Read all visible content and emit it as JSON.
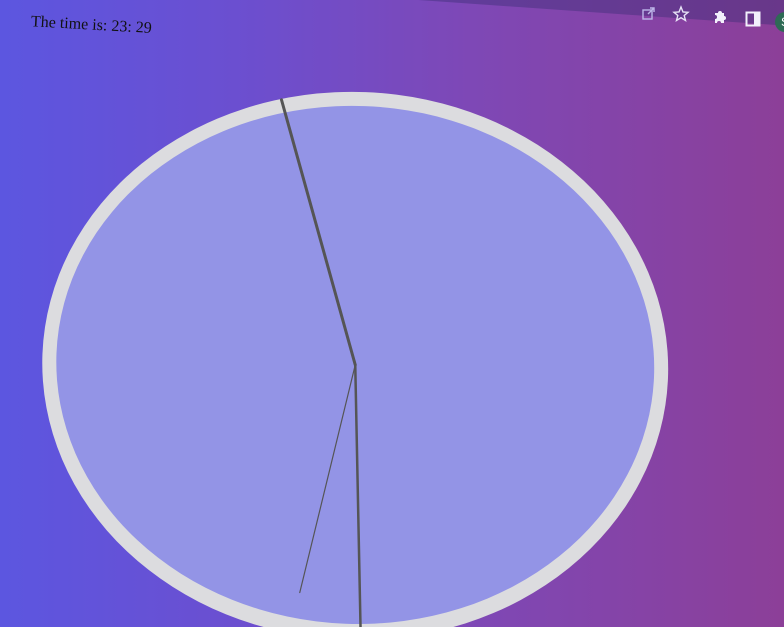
{
  "page": {
    "time_label": "The time is: 23: 29"
  },
  "browser_toolbar": {
    "icons": [
      "share-icon",
      "bookmark-star-icon",
      "extensions-puzzle-icon",
      "side-panel-icon",
      "profile-avatar"
    ],
    "avatar_initial": "S"
  },
  "clock": {
    "hour": 23,
    "minute": 29,
    "second": 31,
    "colors": {
      "rim": "#dcdcdf",
      "face": "#9394e6",
      "hands": "#555555"
    }
  },
  "colors": {
    "background_left": "#5c56e0",
    "background_right": "#8c3f98"
  }
}
